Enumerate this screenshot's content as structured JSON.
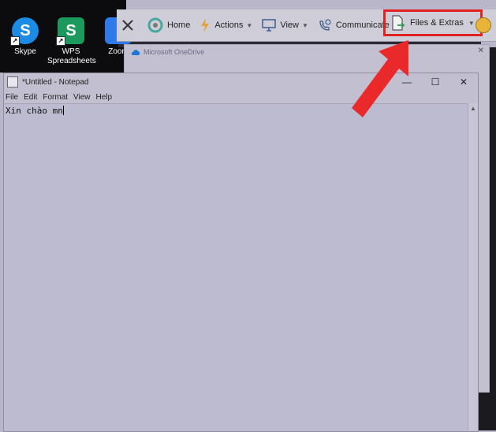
{
  "desktop": {
    "icons": [
      {
        "label": "Skype",
        "glyph": "S",
        "color": "#1b8be6"
      },
      {
        "label": "WPS Spreadsheets",
        "glyph": "S",
        "color": "#1c9a5d"
      },
      {
        "label": "Zoom",
        "glyph": "",
        "color": "#2d7ae8"
      }
    ]
  },
  "toolbar": {
    "home": "Home",
    "actions": "Actions",
    "view": "View",
    "communicate": "Communicate",
    "files_extras": "Files & Extras"
  },
  "onedrive": {
    "title": "Microsoft OneDrive"
  },
  "notepad": {
    "title": "*Untitled - Notepad",
    "menu": [
      "File",
      "Edit",
      "Format",
      "View",
      "Help"
    ],
    "content": "Xin chào mn"
  },
  "colors": {
    "highlight": "#e02222",
    "arrow": "#ea2a2a"
  }
}
